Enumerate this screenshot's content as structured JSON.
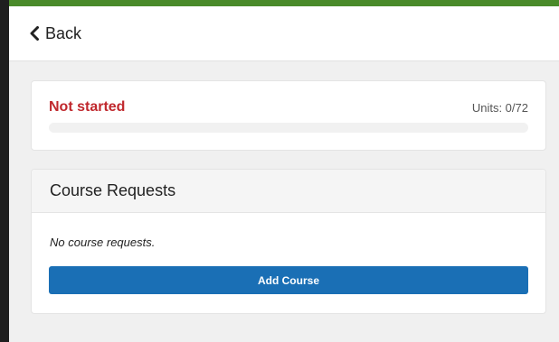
{
  "header": {
    "back_label": "Back"
  },
  "progress": {
    "status": "Not started",
    "units": "Units: 0/72",
    "fraction": 0
  },
  "requests": {
    "title": "Course Requests",
    "empty_message": "No course requests.",
    "add_button_label": "Add Course"
  },
  "colors": {
    "status_red": "#c0282d",
    "button_blue": "#1a6fb5",
    "accent_green": "#4a8a2a"
  },
  "icons": {
    "back": "chevron-left-icon"
  }
}
